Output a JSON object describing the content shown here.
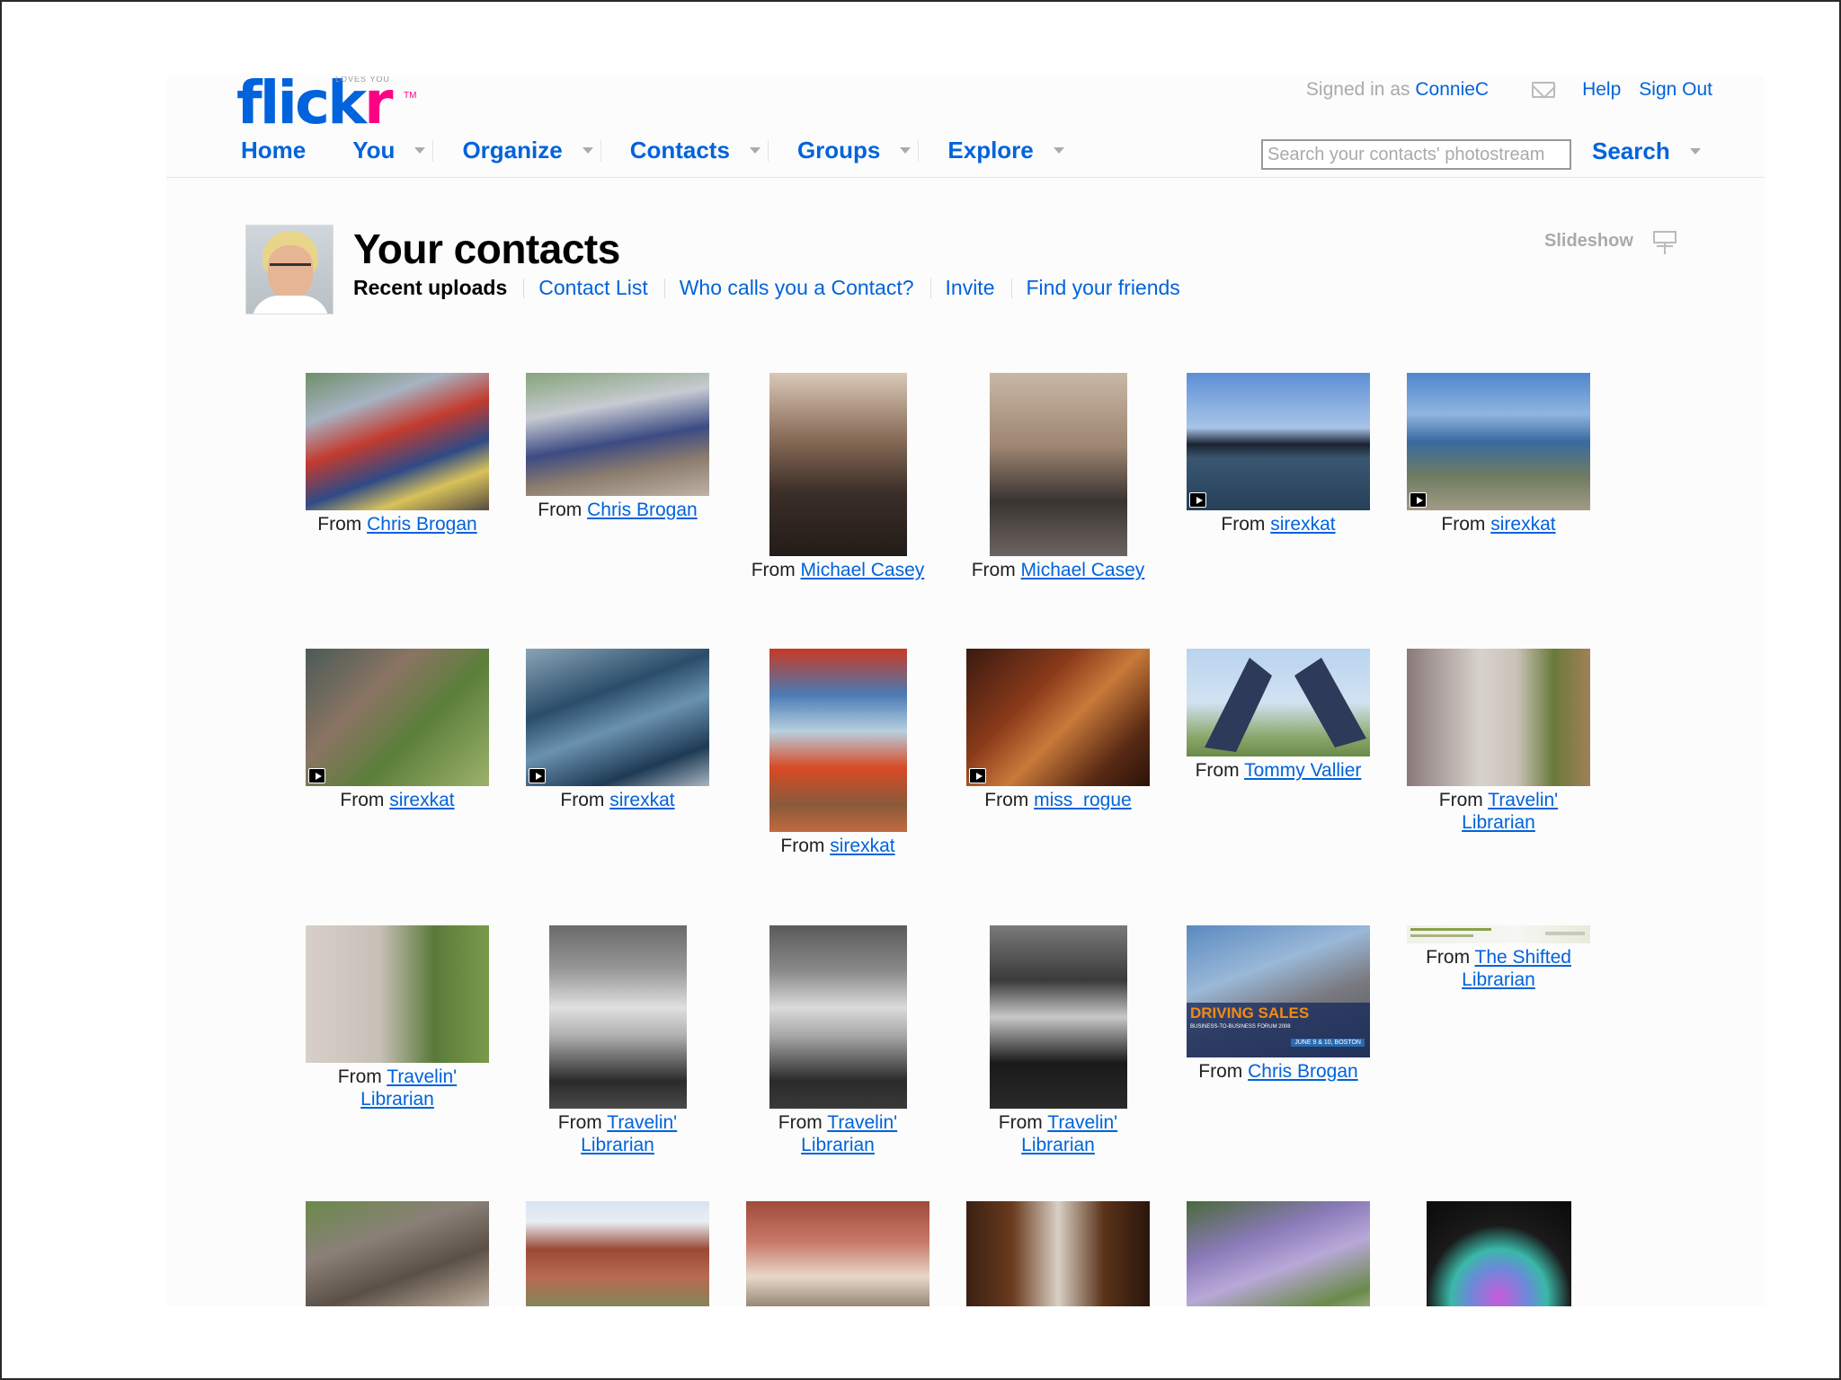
{
  "header": {
    "logo": {
      "flick": "flick",
      "r": "r",
      "tagline": "LOVES YOU",
      "tm": "TM"
    },
    "signed_in_prefix": "Signed in as",
    "username": "ConnieC",
    "help": "Help",
    "sign_out": "Sign Out",
    "nav": [
      "Home",
      "You",
      "Organize",
      "Contacts",
      "Groups",
      "Explore"
    ],
    "search_placeholder": "Search your contacts' photostream",
    "search_label": "Search"
  },
  "main": {
    "title": "Your contacts",
    "tabs": {
      "current": "Recent uploads",
      "contact_list": "Contact List",
      "who_calls": "Who calls you a Contact?",
      "invite": "Invite",
      "find_friends": "Find your friends"
    },
    "slideshow_label": "Slideshow",
    "from_label": "From",
    "photos": [
      {
        "from": "Chris Brogan",
        "video": false
      },
      {
        "from": "Chris Brogan",
        "video": false
      },
      {
        "from": "Michael Casey",
        "video": false
      },
      {
        "from": "Michael Casey",
        "video": false
      },
      {
        "from": "sirexkat",
        "video": true
      },
      {
        "from": "sirexkat",
        "video": true
      },
      {
        "from": "sirexkat",
        "video": true
      },
      {
        "from": "sirexkat",
        "video": true
      },
      {
        "from": "sirexkat",
        "video": false
      },
      {
        "from": "miss_rogue",
        "video": true
      },
      {
        "from": "Tommy Vallier",
        "video": false
      },
      {
        "from": "Travelin' Librarian",
        "video": false
      },
      {
        "from": "Travelin' Librarian",
        "video": false
      },
      {
        "from": "Travelin' Librarian",
        "video": false
      },
      {
        "from": "Travelin' Librarian",
        "video": false
      },
      {
        "from": "Travelin' Librarian",
        "video": false
      },
      {
        "from": "Chris Brogan",
        "video": false
      },
      {
        "from": "The Shifted Librarian",
        "video": false
      }
    ],
    "thumbnail_text": {
      "driving_sales": "DRIVING SALES",
      "forum": "BUSINESS-TO-BUSINESS FORUM 2008",
      "date": "JUNE 9 & 10, BOSTON"
    }
  },
  "colors": {
    "link": "#0063dc",
    "brand_pink": "#ff0084"
  }
}
